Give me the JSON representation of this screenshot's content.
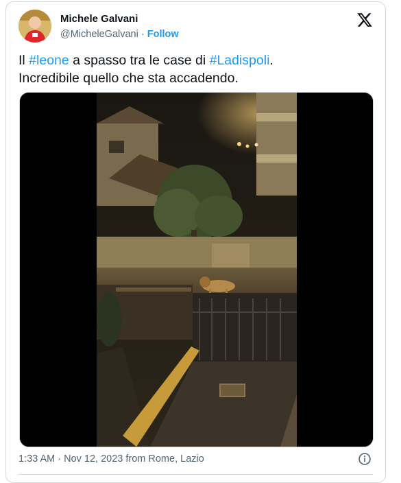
{
  "author": {
    "name": "Michele Galvani",
    "handle": "@MicheleGalvani",
    "separator": "·",
    "follow_label": "Follow",
    "avatar_icon": "profile-avatar"
  },
  "tweet": {
    "prefix": "Il ",
    "hashtag1": "#leone",
    "middle": " a spasso tra le case di ",
    "hashtag2": "#Ladispoli",
    "suffix": ".",
    "line2": "Incredibile quello che sta accadendo."
  },
  "media": {
    "type": "video",
    "description_icon": "video-thumbnail"
  },
  "footer": {
    "timestamp": "1:33 AM · Nov 12, 2023 from Rome, Lazio",
    "info_icon": "info-icon"
  },
  "colors": {
    "accent": "#1d9bf0",
    "text": "#0f1419",
    "secondary": "#536471",
    "border": "#cfd9de"
  }
}
